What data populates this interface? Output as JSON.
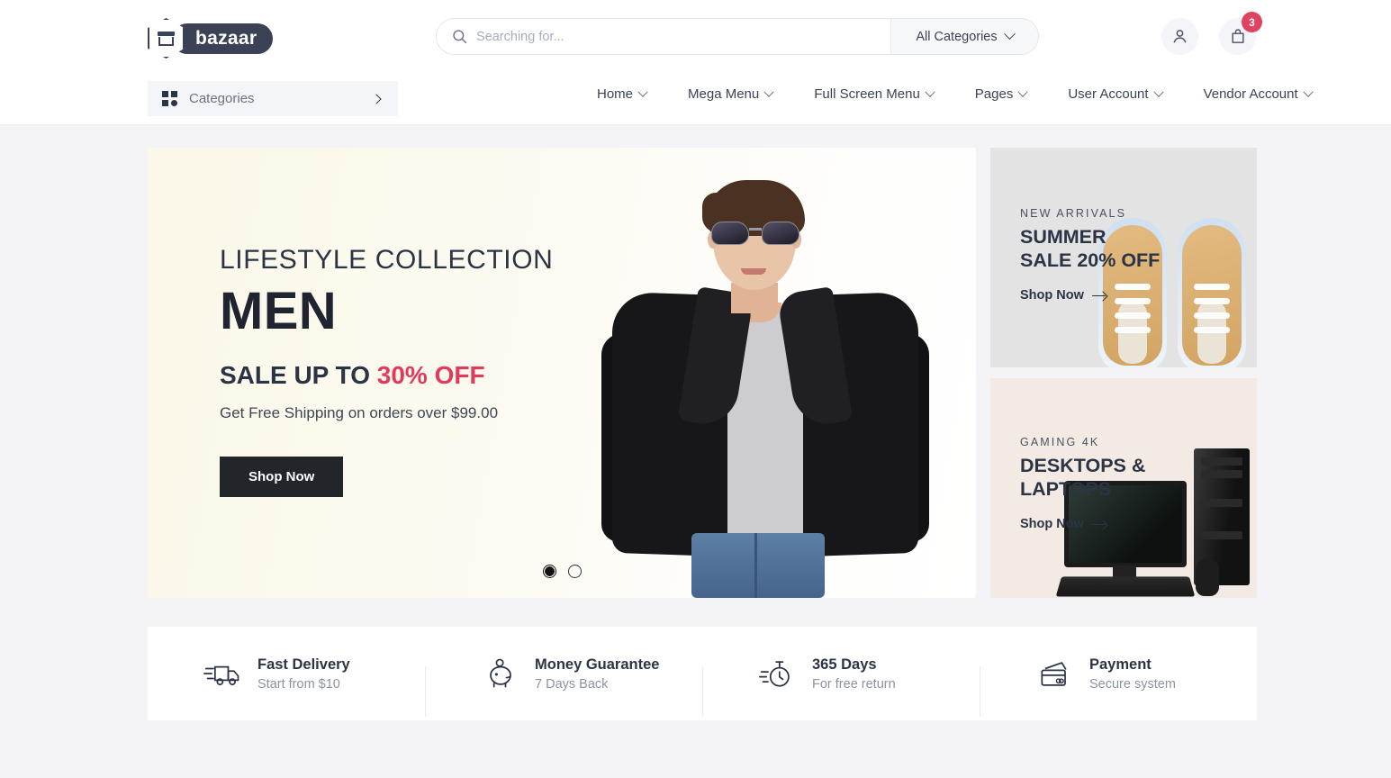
{
  "brand": {
    "name": "bazaar",
    "icon": "shop-hexagon-icon"
  },
  "header": {
    "search": {
      "placeholder": "Searching for...",
      "value": "",
      "icon": "search-icon"
    },
    "category_select": {
      "label": "All Categories",
      "icon": "chevron-down-icon"
    },
    "account": {
      "icon": "user-icon"
    },
    "cart": {
      "icon": "shopping-bag-icon",
      "badge": "3"
    }
  },
  "nav": {
    "categories_button": {
      "label": "Categories",
      "icon": "grid-icon",
      "arrow": "chevron-right-icon"
    },
    "items": [
      {
        "label": "Home",
        "caret": "chevron-down-icon"
      },
      {
        "label": "Mega Menu",
        "caret": "chevron-down-icon"
      },
      {
        "label": "Full Screen Menu",
        "caret": "chevron-down-icon"
      },
      {
        "label": "Pages",
        "caret": "chevron-down-icon"
      },
      {
        "label": "User Account",
        "caret": "chevron-down-icon"
      },
      {
        "label": "Vendor Account",
        "caret": "chevron-down-icon"
      }
    ]
  },
  "hero": {
    "subtitle": "LIFESTYLE COLLECTION",
    "title": "MEN",
    "sale_prefix": "SALE UP TO ",
    "sale_highlight": "30% OFF",
    "shipping": "Get Free Shipping on orders over $99.00",
    "cta": "Shop Now",
    "accent_color": "#e23a5c",
    "slides": 2,
    "active_slide": 1
  },
  "banners": [
    {
      "eyebrow": "NEW ARRIVALS",
      "title_line1": "SUMMER",
      "title_line2": "SALE 20% OFF",
      "link": "Shop Now",
      "link_icon": "arrow-right-icon",
      "background": "#e3e3e3",
      "image": "tan-sneakers"
    },
    {
      "eyebrow": "GAMING 4K",
      "title_line1": "DESKTOPS &",
      "title_line2": "LAPTOPS",
      "link": "Shop Now",
      "link_icon": "arrow-right-icon",
      "background": "#f3eae4",
      "image": "desktop-computer"
    }
  ],
  "services": [
    {
      "icon": "delivery-truck-icon",
      "title": "Fast Delivery",
      "subtitle": "Start from $10"
    },
    {
      "icon": "piggy-bank-icon",
      "title": "Money Guarantee",
      "subtitle": "7 Days Back"
    },
    {
      "icon": "stopwatch-icon",
      "title": "365 Days",
      "subtitle": "For free return"
    },
    {
      "icon": "credit-card-icon",
      "title": "Payment",
      "subtitle": "Secure system"
    }
  ]
}
